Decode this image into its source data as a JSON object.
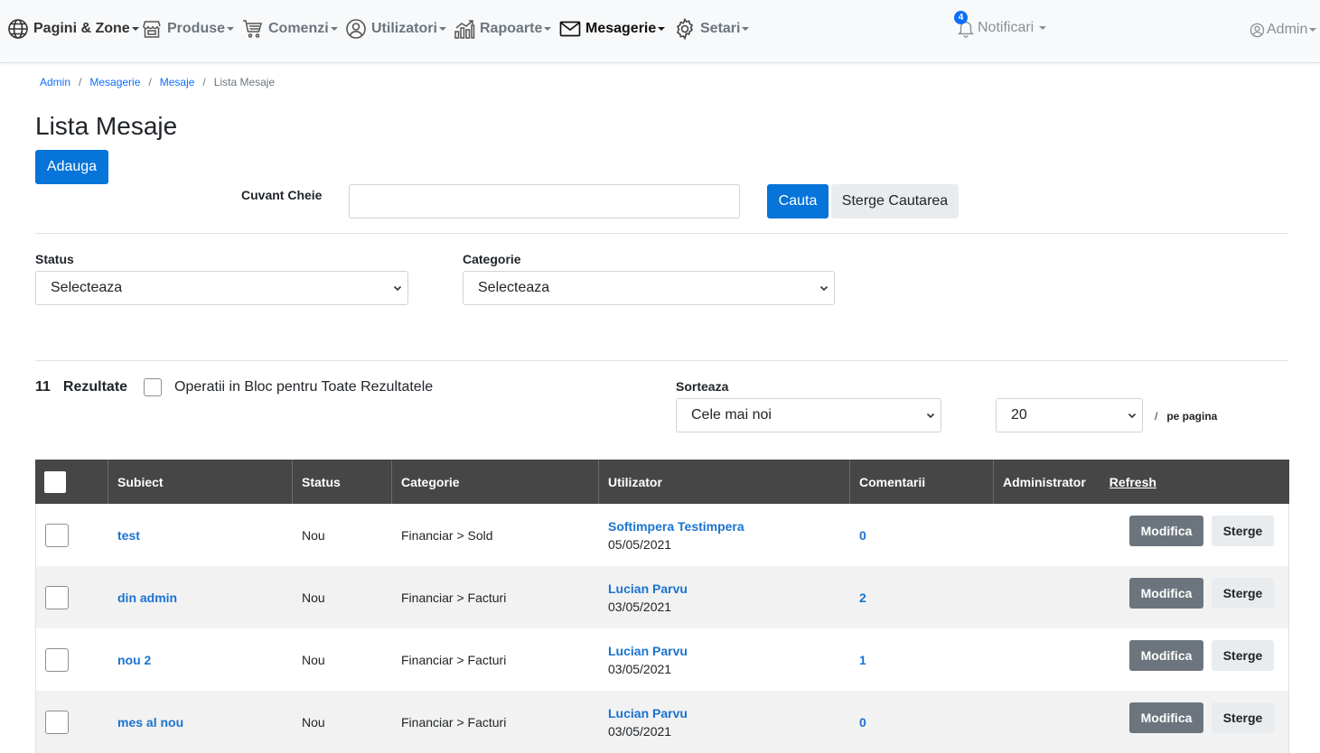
{
  "nav": {
    "items": [
      {
        "label": "Pagini & Zone",
        "icon": "globe-icon"
      },
      {
        "label": "Produse",
        "icon": "store-icon"
      },
      {
        "label": "Comenzi",
        "icon": "cart-icon"
      },
      {
        "label": "Utilizatori",
        "icon": "user-circle-icon"
      },
      {
        "label": "Rapoarte",
        "icon": "chart-icon"
      },
      {
        "label": "Mesagerie",
        "icon": "envelope-icon"
      },
      {
        "label": "Setari",
        "icon": "gear-icon"
      }
    ],
    "notifications": {
      "label": "Notificari",
      "count": "4"
    },
    "user": {
      "label": "Admin"
    }
  },
  "breadcrumb": [
    "Admin",
    "Mesagerie",
    "Mesaje",
    "Lista Mesaje"
  ],
  "page": {
    "title": "Lista Mesaje",
    "add_label": "Adauga"
  },
  "search": {
    "keyword_label": "Cuvant Cheie",
    "keyword_value": "",
    "search_label": "Cauta",
    "clear_label": "Sterge Cautarea"
  },
  "filters": {
    "status_label": "Status",
    "status_value": "Selecteaza",
    "category_label": "Categorie",
    "category_value": "Selecteaza"
  },
  "results": {
    "count": "11",
    "label": "Rezultate",
    "bulk_label": "Operatii in Bloc pentru Toate Rezultatele",
    "sort_label": "Sorteaza",
    "sort_value": "Cele mai noi",
    "per_page_value": "20",
    "per_page_slash": "/",
    "per_page_label": "pe pagina"
  },
  "table": {
    "headers": {
      "subject": "Subiect",
      "status": "Status",
      "category": "Categorie",
      "user": "Utilizator",
      "comments": "Comentarii",
      "admin": "Administrator",
      "refresh": "Refresh"
    },
    "edit_label": "Modifica",
    "delete_label": "Sterge",
    "rows": [
      {
        "subject": "test",
        "status": "Nou",
        "category": "Financiar > Sold",
        "user": "Softimpera Testimpera",
        "date": "05/05/2021",
        "comments": "0"
      },
      {
        "subject": "din admin",
        "status": "Nou",
        "category": "Financiar > Facturi",
        "user": "Lucian Parvu",
        "date": "03/05/2021",
        "comments": "2"
      },
      {
        "subject": "nou 2",
        "status": "Nou",
        "category": "Financiar > Facturi",
        "user": "Lucian Parvu",
        "date": "03/05/2021",
        "comments": "1"
      },
      {
        "subject": "mes al nou",
        "status": "Nou",
        "category": "Financiar > Facturi",
        "user": "Lucian Parvu",
        "date": "03/05/2021",
        "comments": "0"
      }
    ]
  }
}
